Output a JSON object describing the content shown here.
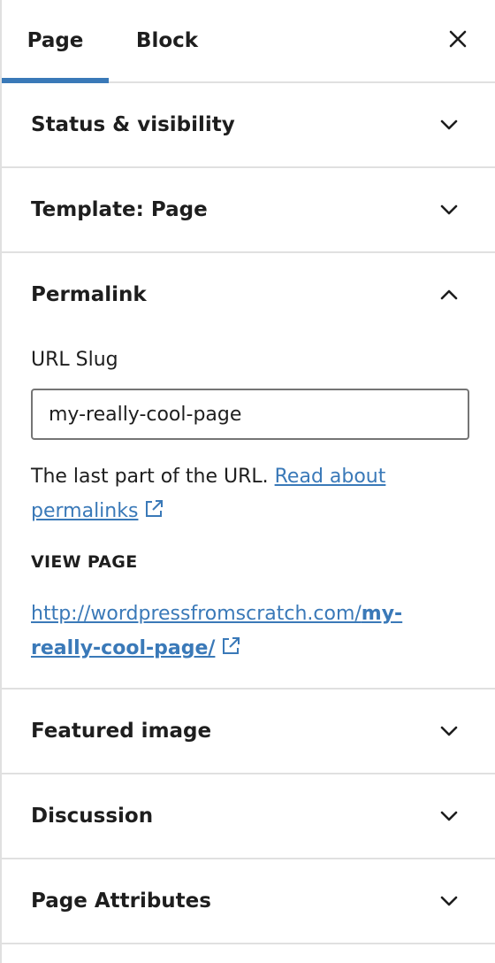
{
  "tabs": {
    "page_label": "Page",
    "block_label": "Block",
    "active": "Page",
    "close_icon": "close-icon"
  },
  "panels": {
    "status": {
      "title": "Status & visibility",
      "expanded": false
    },
    "template": {
      "title": "Template: Page",
      "expanded": false
    },
    "permalink": {
      "title": "Permalink",
      "expanded": true,
      "url_slug_label": "URL Slug",
      "url_slug_value": "my-really-cool-page",
      "help_text": "The last part of the URL. ",
      "help_link_text": "Read about permalinks",
      "view_page_label": "VIEW PAGE",
      "view_url_base": "http://wordpressfromscratch.com/",
      "view_url_slug": "my-really-cool-page/"
    },
    "featured_image": {
      "title": "Featured image",
      "expanded": false
    },
    "discussion": {
      "title": "Discussion",
      "expanded": false
    },
    "page_attributes": {
      "title": "Page Attributes",
      "expanded": false
    }
  },
  "colors": {
    "accent": "#3a79b8",
    "border": "#e0e0e0",
    "text": "#1e1e1e"
  }
}
